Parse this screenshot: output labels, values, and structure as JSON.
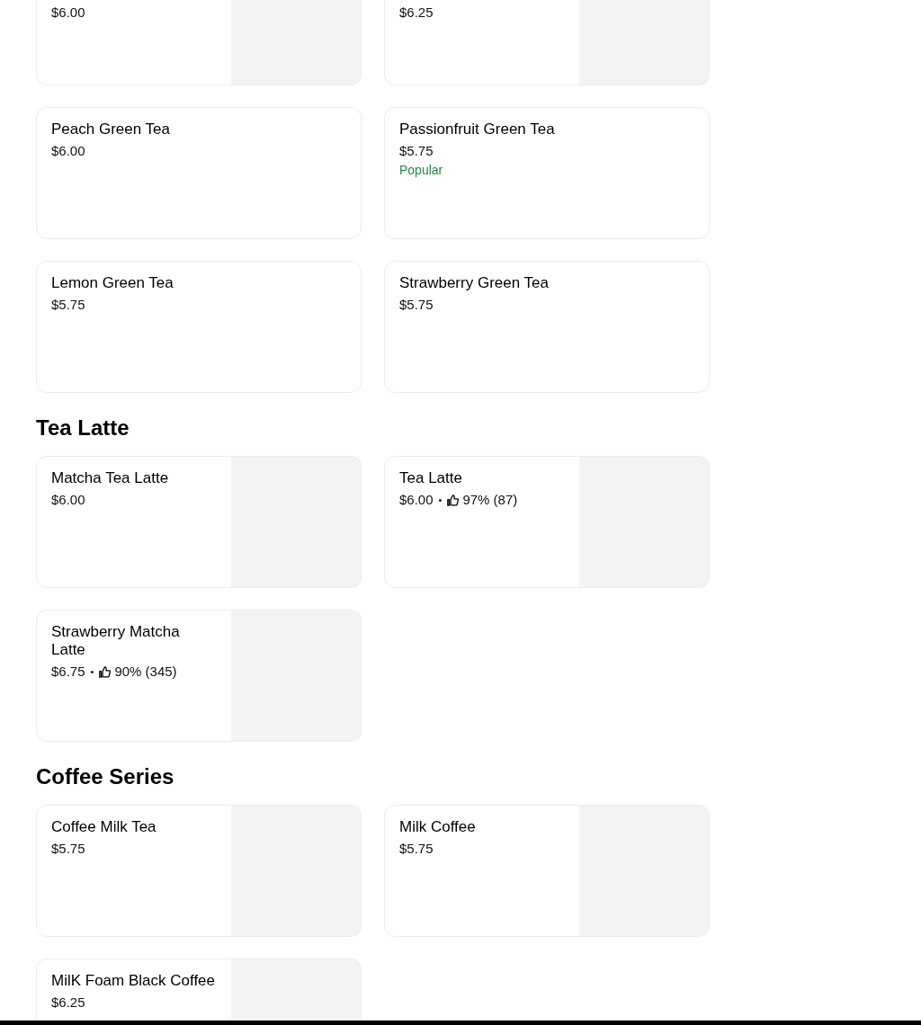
{
  "sections": [
    {
      "items": [
        {
          "price": "$6.00",
          "image": true
        },
        {
          "price": "$6.25",
          "image": true
        },
        {
          "name": "Peach Green Tea",
          "price": "$6.00",
          "image": false
        },
        {
          "name": "Passionfruit Green Tea",
          "price": "$5.75",
          "badge": "Popular",
          "image": false
        },
        {
          "name": "Lemon Green Tea",
          "price": "$5.75",
          "image": false
        },
        {
          "name": "Strawberry Green Tea",
          "price": "$5.75",
          "image": false
        }
      ]
    },
    {
      "title": "Tea Latte",
      "items": [
        {
          "name": "Matcha Tea Latte",
          "price": "$6.00",
          "image": true
        },
        {
          "name": "Tea Latte",
          "price": "$6.00",
          "separator": "•",
          "rating": "97% (87)",
          "image": true
        },
        {
          "name": "Strawberry Matcha Latte",
          "price": "$6.75",
          "separator": "•",
          "rating": "90% (345)",
          "image": true
        }
      ]
    },
    {
      "title": "Coffee Series",
      "items": [
        {
          "name": "Coffee Milk Tea",
          "price": "$5.75",
          "image": true
        },
        {
          "name": "Milk Coffee",
          "price": "$5.75",
          "image": true
        },
        {
          "name": "MilK Foam Black Coffee",
          "price": "$6.25",
          "image": true
        }
      ]
    }
  ]
}
